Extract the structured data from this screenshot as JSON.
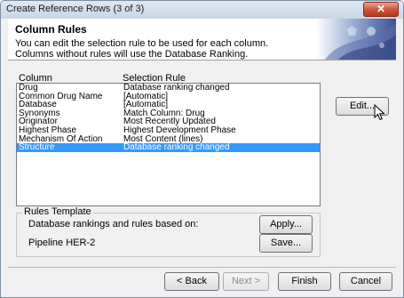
{
  "window": {
    "title": "Create Reference Rows (3 of 3)",
    "close_glyph": "✕"
  },
  "header": {
    "title": "Column Rules",
    "desc_line1": "You can edit the selection rule to be used for each column.",
    "desc_line2": "Columns without rules will use the Database Ranking."
  },
  "table": {
    "headers": {
      "column": "Column",
      "rule": "Selection Rule"
    },
    "rows": [
      {
        "column": "Drug",
        "rule": "Database ranking changed"
      },
      {
        "column": "Common Drug Name",
        "rule": "[Automatic]"
      },
      {
        "column": "Database",
        "rule": "[Automatic]"
      },
      {
        "column": "Synonyms",
        "rule": "Match Column: Drug"
      },
      {
        "column": "Originator",
        "rule": "Most Recently Updated"
      },
      {
        "column": "Highest Phase",
        "rule": "Highest Development Phase"
      },
      {
        "column": "Mechanism Of Action",
        "rule": "Most Content (lines)"
      },
      {
        "column": "Structure",
        "rule": "Database ranking changed",
        "selected": true
      }
    ]
  },
  "buttons": {
    "edit": "Edit...",
    "apply": "Apply...",
    "save": "Save...",
    "back": "< Back",
    "next": "Next >",
    "finish": "Finish",
    "cancel": "Cancel"
  },
  "rules_template": {
    "legend": "Rules Template",
    "text1": "Database rankings and rules based on:",
    "text2": "Pipeline HER-2"
  },
  "colors": {
    "selection": "#3399ff",
    "close_button": "#c85438",
    "header_bg": "#ffffff"
  },
  "icons": {
    "cursor": "mouse-pointer-icon"
  }
}
